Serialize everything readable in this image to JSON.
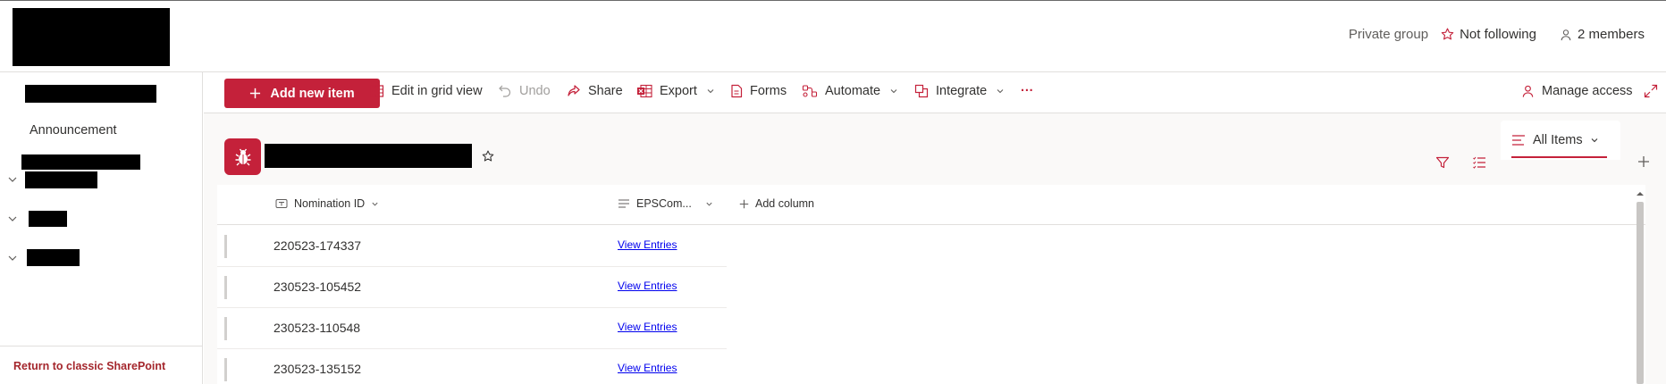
{
  "header": {
    "privacy": "Private group",
    "follow_label": "Not following",
    "members_label": "2 members"
  },
  "nav": {
    "items": [
      {
        "label": "Announcement"
      }
    ],
    "classic_link": "Return to classic SharePoint"
  },
  "toolbar": {
    "add_new_item": "Add new item",
    "edit_grid": "Edit in grid view",
    "undo": "Undo",
    "share": "Share",
    "export": "Export",
    "forms": "Forms",
    "automate": "Automate",
    "integrate": "Integrate",
    "more": "···",
    "manage_access": "Manage access"
  },
  "list": {
    "view_name": "All Items",
    "columns": [
      "Nomination ID",
      "EPSCom...",
      "Add column"
    ],
    "rows": [
      {
        "id": "220523-174337",
        "link": "View Entries"
      },
      {
        "id": "230523-105452",
        "link": "View Entries"
      },
      {
        "id": "230523-110548",
        "link": "View Entries"
      },
      {
        "id": "230523-135152",
        "link": "View Entries"
      }
    ]
  },
  "colors": {
    "accent": "#c4213a",
    "link": "#0000ee",
    "classic_link": "#a4262c"
  },
  "icons": [
    "star-icon",
    "person-icon",
    "plus-icon",
    "grid-icon",
    "undo-icon",
    "share-icon",
    "excel-icon",
    "forms-icon",
    "automate-icon",
    "integrate-icon",
    "more-icon",
    "manage-access-icon",
    "expand-icon",
    "bug-icon",
    "filter-icon",
    "list-options-icon",
    "view-icon",
    "chevron-down-icon",
    "text-field-icon",
    "multiline-icon"
  ]
}
